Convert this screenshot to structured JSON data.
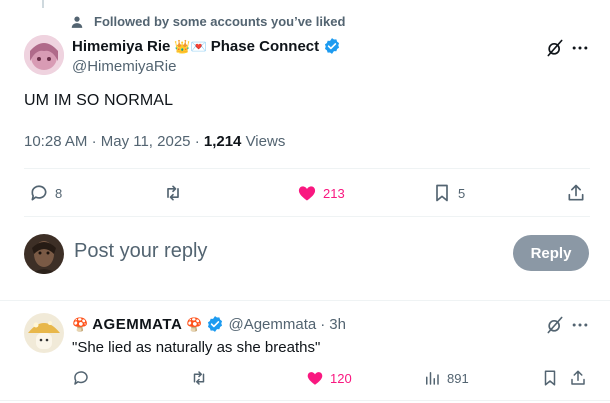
{
  "social_context": {
    "text": "Followed by some accounts you’ve liked",
    "icon": "person-icon"
  },
  "tweet": {
    "author_name": "Himemiya Rie",
    "name_emojis": "👑💌",
    "affiliation": "Phase Connect",
    "handle": "@HimemiyaRie",
    "text": "UM IM SO NORMAL",
    "time": "10:28 AM",
    "date": "May 11, 2025",
    "views_count": "1,214",
    "views_label": "Views",
    "separator": "·",
    "replies": "8",
    "reposts": "",
    "likes": "213",
    "bookmarks": "5"
  },
  "composer": {
    "placeholder": "Post your reply",
    "button_label": "Reply"
  },
  "reply": {
    "author_prefix": "🍄",
    "author_name": "AGEMMATA",
    "author_suffix": "🍄",
    "handle": "@Agemmata",
    "separator": "·",
    "age": "3h",
    "text": "\"She lied as naturally as she breaths\"",
    "replies": "",
    "reposts": "",
    "likes": "120",
    "views": "891"
  },
  "colors": {
    "accent": "#1d9bf0",
    "like": "#f91880",
    "muted": "#536471",
    "reply_button": "#8b98a5"
  }
}
